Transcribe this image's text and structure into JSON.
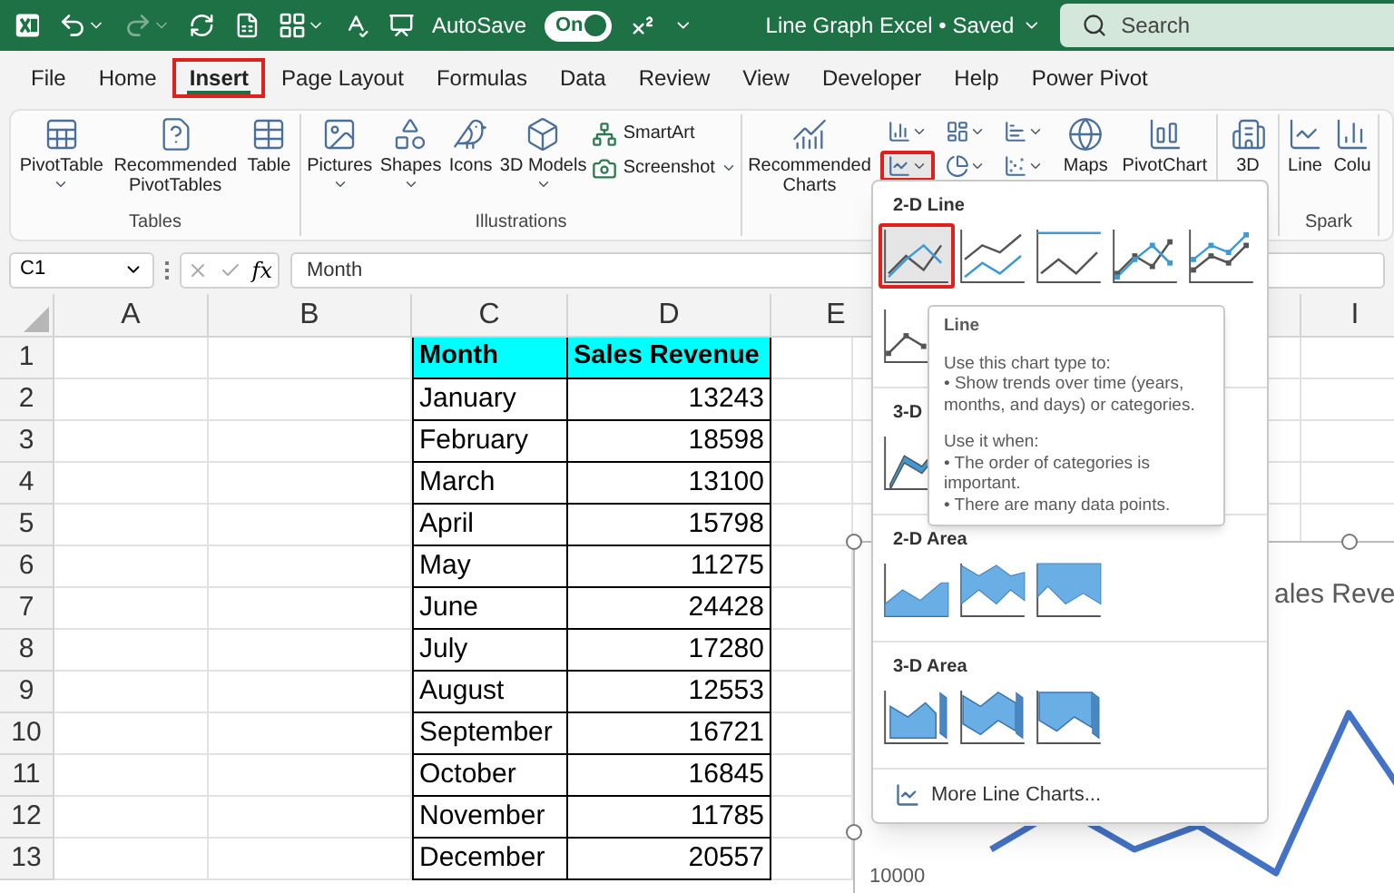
{
  "title_bar": {
    "redo": {
      "disabled": true
    },
    "autosave_label": "AutoSave",
    "autosave": {
      "on": true,
      "label": "On"
    },
    "title": "Line Graph Excel • Saved",
    "search": {
      "placeholder": "Search"
    }
  },
  "tabs": [
    {
      "label": "File",
      "selected": false,
      "highlighted": false
    },
    {
      "label": "Home",
      "selected": false,
      "highlighted": false
    },
    {
      "label": "Insert",
      "selected": true,
      "highlighted": true
    },
    {
      "label": "Page Layout",
      "selected": false,
      "highlighted": false
    },
    {
      "label": "Formulas",
      "selected": false,
      "highlighted": false
    },
    {
      "label": "Data",
      "selected": false,
      "highlighted": false
    },
    {
      "label": "Review",
      "selected": false,
      "highlighted": false
    },
    {
      "label": "View",
      "selected": false,
      "highlighted": false
    },
    {
      "label": "Developer",
      "selected": false,
      "highlighted": false
    },
    {
      "label": "Help",
      "selected": false,
      "highlighted": false
    },
    {
      "label": "Power Pivot",
      "selected": false,
      "highlighted": false
    }
  ],
  "ribbon": [
    {
      "label": "Tables",
      "items": [
        {
          "kind": "large",
          "label": "PivotTable",
          "dropdown": true
        },
        {
          "kind": "large",
          "label": "Recommended PivotTables",
          "dropdown": false
        },
        {
          "kind": "large",
          "label": "Table",
          "dropdown": false
        }
      ]
    },
    {
      "label": "Illustrations",
      "items": [
        {
          "kind": "large",
          "label": "Pictures",
          "dropdown": true
        },
        {
          "kind": "large",
          "label": "Shapes",
          "dropdown": true
        },
        {
          "kind": "large",
          "label": "Icons",
          "dropdown": false
        },
        {
          "kind": "large",
          "label": "3D Models",
          "dropdown": true
        },
        {
          "kind": "small_stack",
          "items": [
            {
              "label": "SmartArt",
              "dropdown": false
            },
            {
              "label": "Screenshot",
              "dropdown": true
            }
          ]
        }
      ]
    },
    {
      "items": [
        {
          "kind": "large",
          "label": "Recommended Charts",
          "dropdown": false
        },
        {
          "kind": "icon_grid",
          "items": [
            {
              "dropdown": true,
              "highlighted": false
            },
            {
              "dropdown": true,
              "highlighted": false
            },
            {
              "dropdown": true,
              "highlighted": false
            },
            {
              "dropdown": true,
              "highlighted": true
            },
            {
              "dropdown": true,
              "highlighted": false
            },
            {
              "dropdown": true,
              "highlighted": false
            }
          ]
        },
        {
          "kind": "large",
          "label": "Maps",
          "dropdown": false
        },
        {
          "kind": "large",
          "label": "PivotChart",
          "dropdown": false
        }
      ]
    },
    {
      "items": [
        {
          "kind": "large",
          "label": "3D",
          "dropdown": false
        }
      ]
    },
    {
      "label": "Spark",
      "items": [
        {
          "kind": "large",
          "label": "Line",
          "dropdown": false
        },
        {
          "kind": "large",
          "label": "Colu",
          "dropdown": false
        }
      ]
    }
  ],
  "formula_bar": {
    "name_box": "C1",
    "function_label": "fx",
    "formula": "Month"
  },
  "sheet": {
    "columns": [
      "A",
      "B",
      "C",
      "D",
      "E",
      "I"
    ],
    "rows": [
      {
        "number": "1",
        "header": true,
        "cells": [
          "Month",
          "Sales Revenue"
        ]
      },
      {
        "number": "2",
        "header": false,
        "cells": [
          "January",
          "13243"
        ]
      },
      {
        "number": "3",
        "header": false,
        "cells": [
          "February",
          "18598"
        ]
      },
      {
        "number": "4",
        "header": false,
        "cells": [
          "March",
          "13100"
        ]
      },
      {
        "number": "5",
        "header": false,
        "cells": [
          "April",
          "15798"
        ]
      },
      {
        "number": "6",
        "header": false,
        "cells": [
          "May",
          "11275"
        ]
      },
      {
        "number": "7",
        "header": false,
        "cells": [
          "June",
          "24428"
        ]
      },
      {
        "number": "8",
        "header": false,
        "cells": [
          "July",
          "17280"
        ]
      },
      {
        "number": "9",
        "header": false,
        "cells": [
          "August",
          "12553"
        ]
      },
      {
        "number": "10",
        "header": false,
        "cells": [
          "September",
          "16721"
        ]
      },
      {
        "number": "11",
        "header": false,
        "cells": [
          "October",
          "16845"
        ]
      },
      {
        "number": "12",
        "header": false,
        "cells": [
          "November",
          "11785"
        ]
      },
      {
        "number": "13",
        "header": false,
        "cells": [
          "December",
          "20557"
        ]
      }
    ]
  },
  "chart": {
    "title": "ales Reve",
    "axis_labels": [
      "10000"
    ]
  },
  "chart_menu": {
    "sections": [
      {
        "title": "2-D Line",
        "options": [
          {
            "selected": true,
            "highlighted": true
          },
          {
            "selected": false,
            "highlighted": false
          },
          {
            "selected": false,
            "highlighted": false
          },
          {
            "selected": false,
            "highlighted": false
          },
          {
            "selected": false,
            "highlighted": false
          },
          {
            "selected": false,
            "highlighted": false
          }
        ]
      },
      {
        "title": "3-D",
        "options": [
          {
            "selected": false,
            "highlighted": false
          }
        ]
      },
      {
        "title": "2-D Area",
        "options": [
          {
            "selected": false,
            "highlighted": false
          },
          {
            "selected": false,
            "highlighted": false
          },
          {
            "selected": false,
            "highlighted": false
          }
        ]
      },
      {
        "title": "3-D Area",
        "options": [
          {
            "selected": false,
            "highlighted": false
          },
          {
            "selected": false,
            "highlighted": false
          },
          {
            "selected": false,
            "highlighted": false
          }
        ]
      }
    ],
    "footer": "More Line Charts...",
    "tooltip": {
      "title": "Line",
      "paragraphs": [
        {
          "heading": "Use this chart type to:",
          "bullets": [
            "• Show trends over time (years, months, and days) or categories."
          ]
        },
        {
          "heading": "Use it when:",
          "bullets": [
            "• The order of categories is important.",
            "• There are many data points."
          ]
        }
      ]
    }
  }
}
